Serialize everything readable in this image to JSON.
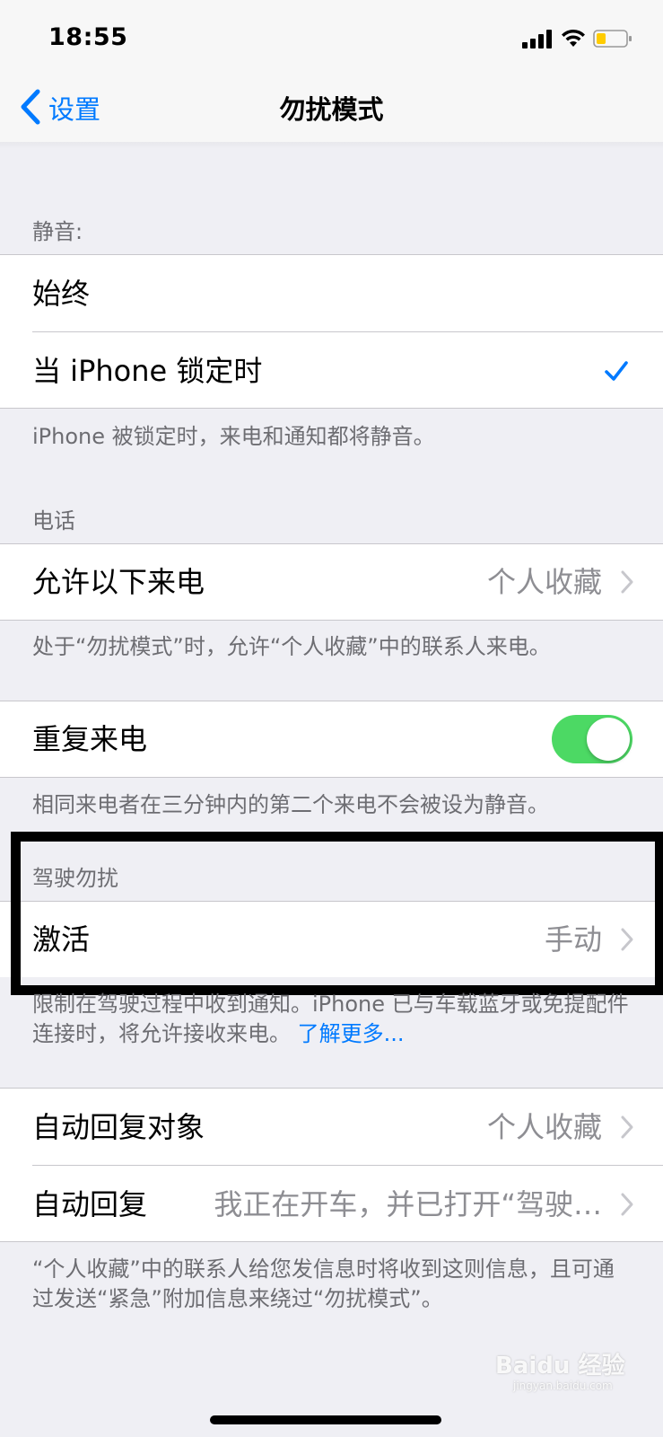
{
  "status_bar": {
    "time": "18:55"
  },
  "nav": {
    "back_label": "设置",
    "title": "勿扰模式"
  },
  "silence_section": {
    "header": "静音:",
    "options": [
      {
        "label": "始终",
        "checked": false
      },
      {
        "label": "当 iPhone 锁定时",
        "checked": true
      }
    ],
    "footer": "iPhone 被锁定时，来电和通知都将静音。"
  },
  "phone_section": {
    "header": "电话",
    "allow_calls_label": "允许以下来电",
    "allow_calls_value": "个人收藏",
    "allow_calls_footer": "处于“勿扰模式”时，允许“个人收藏”中的联系人来电。",
    "repeated_calls_label": "重复来电",
    "repeated_calls_on": true,
    "repeated_calls_footer": "相同来电者在三分钟内的第二个来电不会被设为静音。"
  },
  "driving_section": {
    "header": "驾驶勿扰",
    "activate_label": "激活",
    "activate_value": "手动",
    "footer": "限制在驾驶过程中收到通知。iPhone 已与车载蓝牙或免提配件连接时，将允许接收来电。",
    "footer_link": "了解更多..."
  },
  "auto_reply_section": {
    "auto_reply_to_label": "自动回复对象",
    "auto_reply_to_value": "个人收藏",
    "auto_reply_label": "自动回复",
    "auto_reply_value": "我正在开车，并已打开“驾驶…",
    "footer": "“个人收藏”中的联系人给您发信息时将收到这则信息，且可通过发送“紧急”附加信息来绕过“勿扰模式”。"
  },
  "watermark": {
    "text": "Baidu 经验",
    "sub": "jingyan.baidu.com"
  },
  "colors": {
    "accent": "#007aff",
    "toggle_on": "#4cd964",
    "background": "#efeff4",
    "secondary_text": "#6d6d72"
  }
}
